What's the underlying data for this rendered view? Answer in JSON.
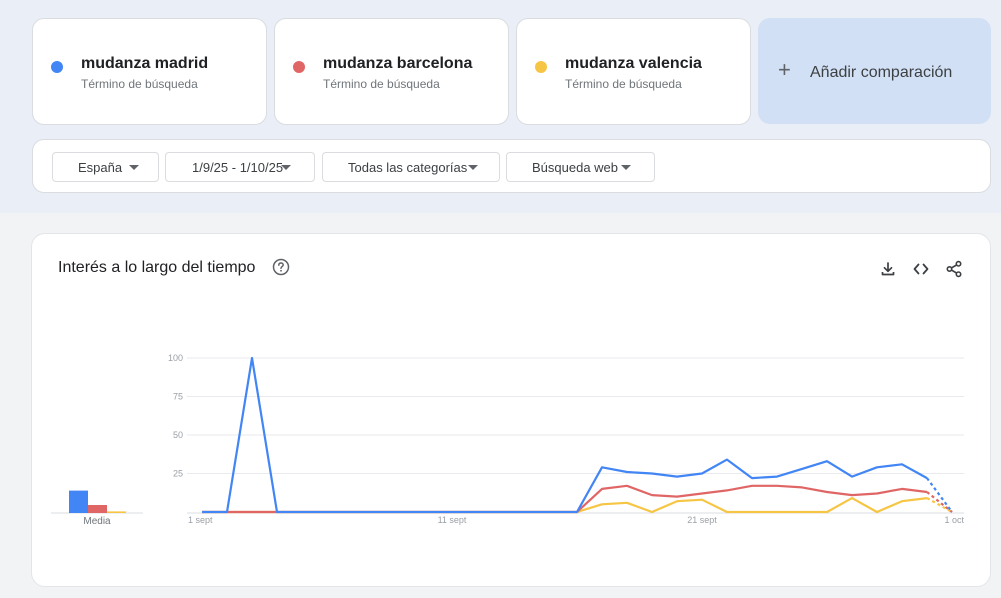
{
  "terms": [
    {
      "label": "mudanza madrid",
      "sub": "Término de búsqueda",
      "color": "#4285f4"
    },
    {
      "label": "mudanza barcelona",
      "sub": "Término de búsqueda",
      "color": "#e06666"
    },
    {
      "label": "mudanza valencia",
      "sub": "Término de búsqueda",
      "color": "#f6c543"
    }
  ],
  "add_comparison": {
    "label": "Añadir comparación"
  },
  "filters": {
    "region": "España",
    "date_range": "1/9/25 - 1/10/25",
    "category": "Todas las categorías",
    "search_type": "Búsqueda web"
  },
  "chart_card": {
    "title": "Interés a lo largo del tiempo"
  },
  "chart_data": {
    "type": "line",
    "x": [
      "2025-09-01",
      "2025-09-02",
      "2025-09-03",
      "2025-09-04",
      "2025-09-05",
      "2025-09-06",
      "2025-09-07",
      "2025-09-08",
      "2025-09-09",
      "2025-09-10",
      "2025-09-11",
      "2025-09-12",
      "2025-09-13",
      "2025-09-14",
      "2025-09-15",
      "2025-09-16",
      "2025-09-17",
      "2025-09-18",
      "2025-09-19",
      "2025-09-20",
      "2025-09-21",
      "2025-09-22",
      "2025-09-23",
      "2025-09-24",
      "2025-09-25",
      "2025-09-26",
      "2025-09-27",
      "2025-09-28",
      "2025-09-29",
      "2025-09-30",
      "2025-10-01"
    ],
    "series": [
      {
        "name": "mudanza madrid",
        "color": "#4285f4",
        "values": [
          0,
          0,
          100,
          0,
          0,
          0,
          0,
          0,
          0,
          0,
          0,
          0,
          0,
          0,
          0,
          0,
          29,
          26,
          25,
          23,
          25,
          34,
          22,
          23,
          28,
          33,
          23,
          29,
          31,
          22,
          0
        ],
        "partial_from": 29
      },
      {
        "name": "mudanza barcelona",
        "color": "#e06666",
        "values": [
          0,
          0,
          0,
          0,
          0,
          0,
          0,
          0,
          0,
          0,
          0,
          0,
          0,
          0,
          0,
          0,
          15,
          17,
          11,
          10,
          12,
          14,
          17,
          17,
          16,
          13,
          11,
          12,
          15,
          13,
          0
        ],
        "partial_from": 29
      },
      {
        "name": "mudanza valencia",
        "color": "#f6c543",
        "values": [
          0,
          0,
          0,
          0,
          0,
          0,
          0,
          0,
          0,
          0,
          0,
          0,
          0,
          0,
          0,
          0,
          5,
          6,
          0,
          7,
          8,
          0,
          0,
          0,
          0,
          0,
          9,
          0,
          7,
          9,
          0
        ],
        "partial_from": 29
      }
    ],
    "x_tick_labels": [
      "1 sept",
      "11 sept",
      "21 sept",
      "1 oct"
    ],
    "x_tick_dates": [
      "2025-09-01",
      "2025-09-11",
      "2025-09-21",
      "2025-10-01"
    ],
    "y_ticks": [
      25,
      50,
      75,
      100
    ],
    "ylim": [
      0,
      100
    ],
    "grid": true,
    "averages": {
      "label": "Media",
      "values": [
        14,
        5,
        1
      ]
    }
  }
}
